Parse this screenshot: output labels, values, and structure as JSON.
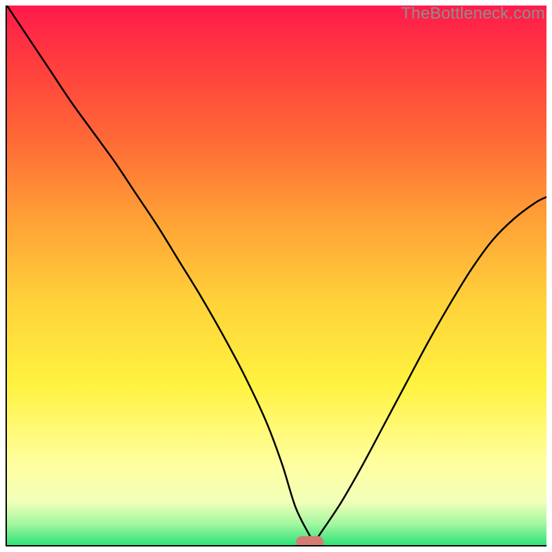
{
  "watermark": {
    "text": "TheBottleneck.com"
  },
  "chart_data": {
    "type": "line",
    "title": "",
    "xlabel": "",
    "ylabel": "",
    "xlim": [
      0,
      100
    ],
    "ylim": [
      0,
      100
    ],
    "grid": false,
    "legend": false,
    "series": [
      {
        "name": "bottleneck-curve",
        "x": [
          0,
          4,
          8,
          12,
          16,
          20,
          24,
          28,
          32,
          36,
          40,
          44,
          48,
          51,
          53.5,
          56,
          57,
          58,
          62,
          66,
          70,
          74,
          78,
          82,
          86,
          90,
          94,
          98,
          100
        ],
        "y": [
          100,
          94,
          88,
          82,
          76.5,
          71,
          65,
          59,
          52.5,
          46,
          39,
          31.5,
          23,
          15,
          7,
          2,
          0.5,
          2,
          8,
          15,
          22.5,
          30,
          37.5,
          44.5,
          51,
          56.5,
          60.5,
          63.5,
          64.5
        ]
      }
    ],
    "marker": {
      "x": 56,
      "y": 0.8,
      "w": 5,
      "h": 2.2
    },
    "colors": {
      "curve": "#000000",
      "marker": "#d67b74",
      "gradient_top": "#ff1a4b",
      "gradient_bottom": "#2fe37a"
    }
  }
}
